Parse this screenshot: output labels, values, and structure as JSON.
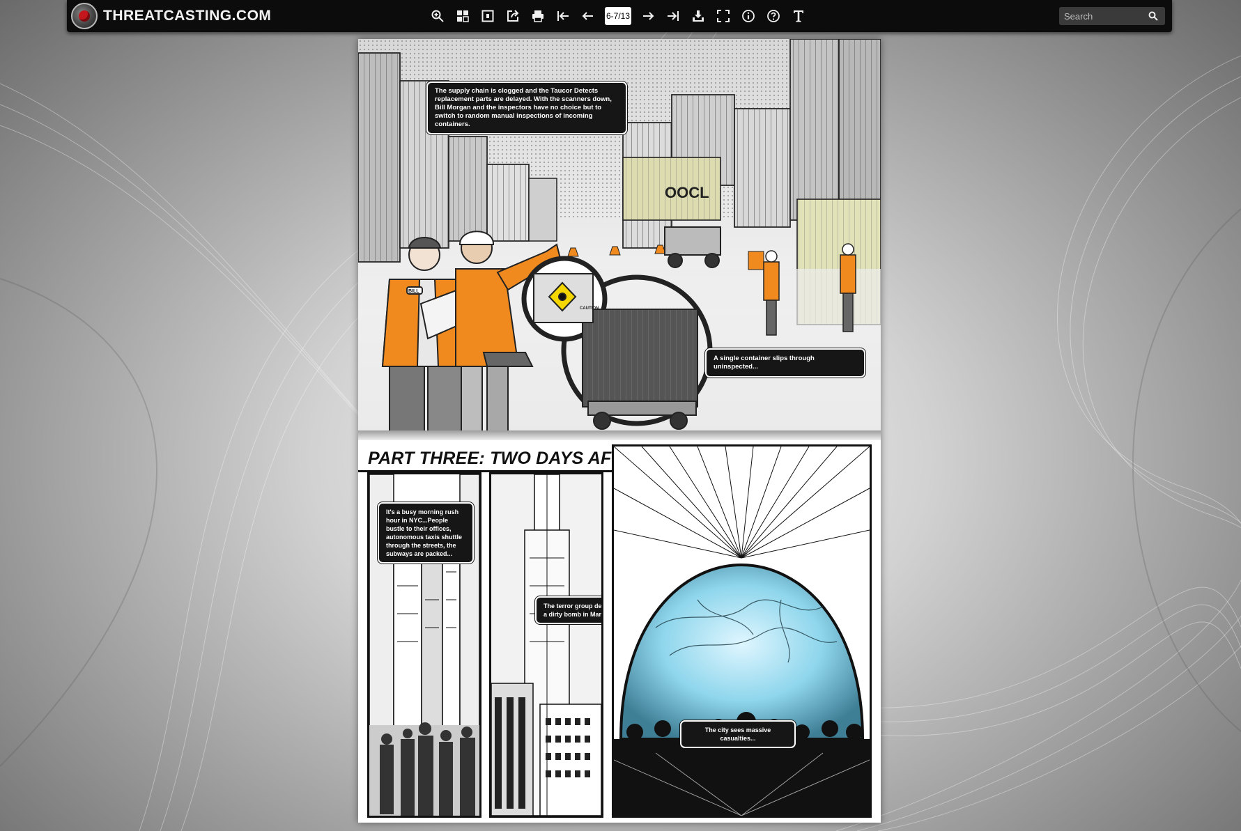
{
  "toolbar": {
    "brand": "THREATCASTING.COM",
    "page_indicator": "6-7/13",
    "search_placeholder": "Search",
    "icons": [
      "zoom-in-icon",
      "thumbnails-icon",
      "single-page-icon",
      "share-icon",
      "print-icon",
      "first-page-icon",
      "previous-page-icon",
      "next-page-icon",
      "last-page-icon",
      "download-icon",
      "fullscreen-icon",
      "info-icon",
      "help-icon",
      "text-icon"
    ]
  },
  "page": {
    "caption_supply_chain": "The supply chain is clogged and the Taucor Detects replacement parts are delayed. With the scanners down, Bill Morgan and the inspectors have no choice but to switch to random manual inspections of incoming containers.",
    "caption_single_container": "A single container slips through uninspected...",
    "badge_name": "BILL",
    "container_brand": "OOCL",
    "label_caution": "CAUTION",
    "part_title": "PART THREE: TWO DAYS AFTER TUESDAY",
    "caption_rush_hour": "It's a busy morning rush hour in NYC...People bustle to their offices, autonomous taxis shuttle through the streets, the subways are packed...",
    "caption_dirty_bomb": "The terror group detonates a dirty bomb in Manhattan...",
    "caption_casualties": "The city sees massive casualties..."
  }
}
